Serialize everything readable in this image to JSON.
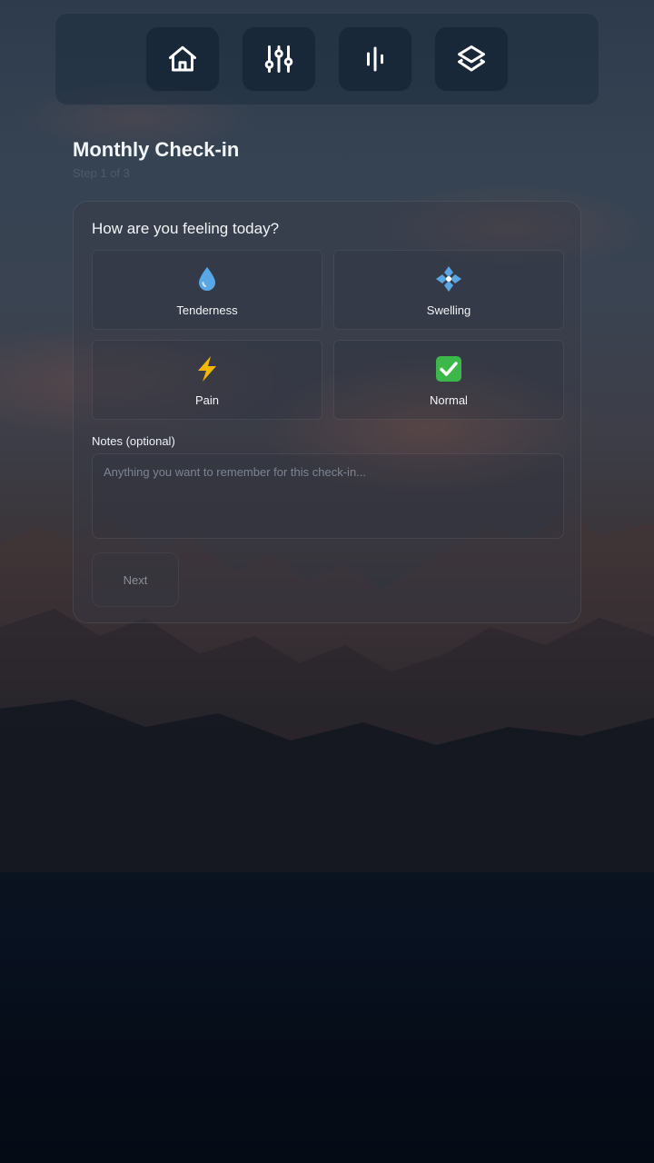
{
  "nav": {
    "items": [
      {
        "icon": "home-icon"
      },
      {
        "icon": "sliders-icon"
      },
      {
        "icon": "audio-bars-icon"
      },
      {
        "icon": "layers-icon"
      }
    ]
  },
  "header": {
    "title": "Monthly Check-in",
    "step": "Step 1 of 3"
  },
  "form": {
    "question": "How are you feeling today?",
    "options": [
      {
        "label": "Tenderness",
        "icon": "droplet-icon"
      },
      {
        "label": "Swelling",
        "icon": "blossom-icon"
      },
      {
        "label": "Pain",
        "icon": "lightning-icon"
      },
      {
        "label": "Normal",
        "icon": "check-mark-icon"
      }
    ],
    "notes_label": "Notes (optional)",
    "notes_placeholder": "Anything you want to remember for this check-in...",
    "notes_value": "",
    "next_label": "Next"
  },
  "colors": {
    "accent_green": "#3cb84a",
    "accent_blue": "#5aa7e6",
    "lightning_yellow": "#f5b800"
  }
}
